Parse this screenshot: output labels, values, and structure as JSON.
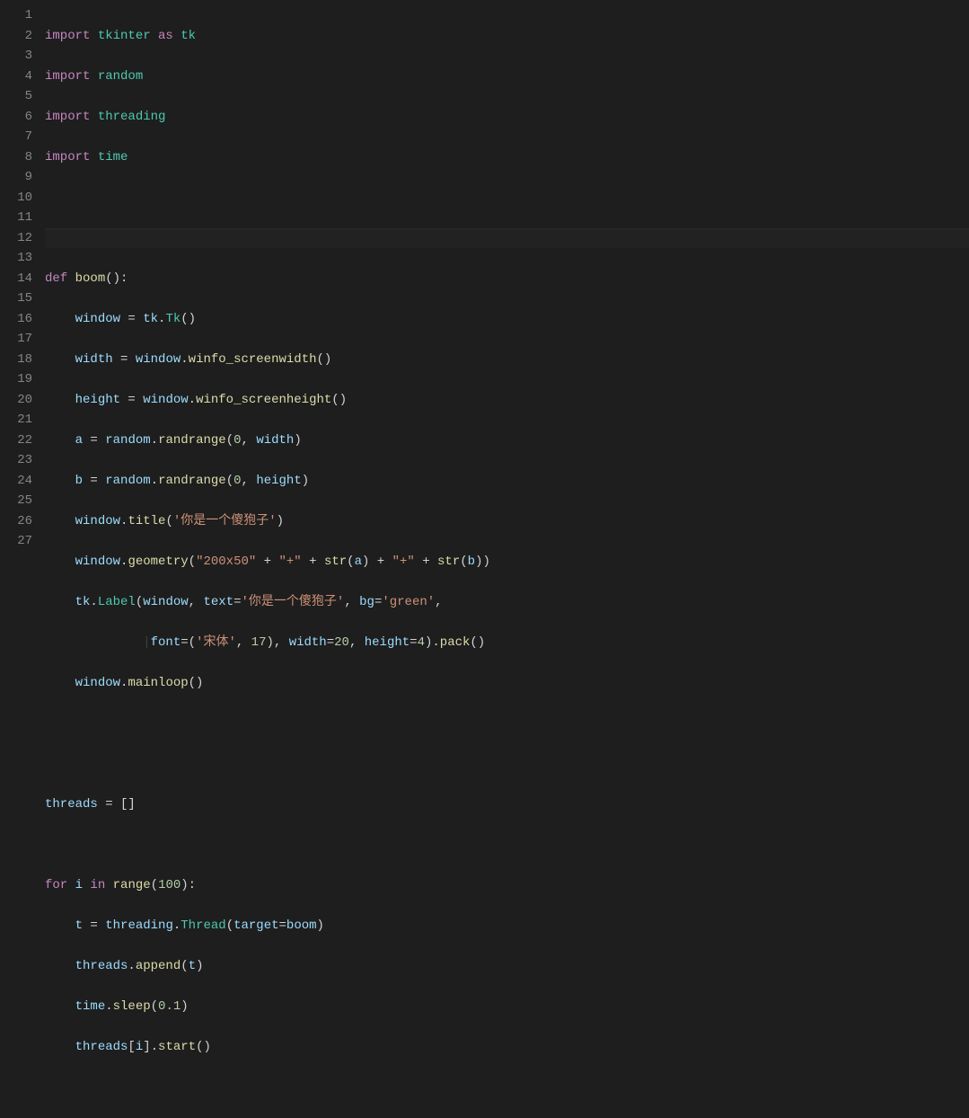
{
  "lineNumbers": [
    "1",
    "2",
    "3",
    "4",
    "5",
    "6",
    "7",
    "8",
    "9",
    "10",
    "11",
    "12",
    "13",
    "14",
    "15",
    "16",
    "17",
    "18",
    "19",
    "20",
    "21",
    "22",
    "23",
    "24",
    "25",
    "26",
    "27"
  ],
  "code": {
    "l1": {
      "import": "import ",
      "tk": "tkinter ",
      "as": "as ",
      "alias": "tk"
    },
    "l2": {
      "import": "import ",
      "mod": "random"
    },
    "l3": {
      "import": "import ",
      "mod": "threading"
    },
    "l4": {
      "import": "import ",
      "mod": "time"
    },
    "l7": {
      "def": "def ",
      "name": "boom",
      "paren": "():"
    },
    "l8": {
      "indent": "    ",
      "window": "window ",
      "eq": "= ",
      "tk": "tk",
      "dot": ".",
      "Tk": "Tk",
      "end": "()"
    },
    "l9": {
      "indent": "    ",
      "width": "width ",
      "eq": "= ",
      "window": "window",
      "dot": ".",
      "fn": "winfo_screenwidth",
      "end": "()"
    },
    "l10": {
      "indent": "    ",
      "height": "height ",
      "eq": "= ",
      "window": "window",
      "dot": ".",
      "fn": "winfo_screenheight",
      "end": "()"
    },
    "l11": {
      "indent": "    ",
      "a": "a ",
      "eq": "= ",
      "random": "random",
      "dot": ".",
      "fn": "randrange",
      "op": "(",
      "zero": "0",
      "comma": ", ",
      "width": "width",
      "cp": ")"
    },
    "l12": {
      "indent": "    ",
      "b": "b ",
      "eq": "= ",
      "random": "random",
      "dot": ".",
      "fn": "randrange",
      "op": "(",
      "zero": "0",
      "comma": ", ",
      "height": "height",
      "cp": ")"
    },
    "l13": {
      "indent": "    ",
      "window": "window",
      "dot": ".",
      "fn": "title",
      "op": "(",
      "str": "'你是一个傻狍子'",
      "cp": ")"
    },
    "l14": {
      "indent": "    ",
      "window": "window",
      "dot": ".",
      "fn": "geometry",
      "op": "(",
      "s1": "\"200x50\"",
      "plus1": " + ",
      "s2": "\"+\"",
      "plus2": " + ",
      "strf": "str",
      "opa": "(",
      "a": "a",
      "cpa": ")",
      "plus3": " + ",
      "s3": "\"+\"",
      "plus4": " + ",
      "strg": "str",
      "opb": "(",
      "b": "b",
      "cpb": ")",
      "cp": ")"
    },
    "l15": {
      "indent": "    ",
      "tk": "tk",
      "dot": ".",
      "Label": "Label",
      "op": "(",
      "window": "window",
      "comma1": ", ",
      "textk": "text",
      "eq1": "=",
      "textv": "'你是一个傻狍子'",
      "comma2": ", ",
      "bgk": "bg",
      "eq2": "=",
      "bgv": "'green'",
      "comma3": ","
    },
    "l16": {
      "indent": "             ",
      "guide": "|",
      "fontk": "font",
      "eq1": "=(",
      "fontname": "'宋体'",
      "comma1": ", ",
      "fontsize": "17",
      "cp1": ")",
      "comma2": ", ",
      "widthk": "width",
      "eq2": "=",
      "widthv": "20",
      "comma3": ", ",
      "heightk": "height",
      "eq3": "=",
      "heightv": "4",
      "cp2": ").",
      "pack": "pack",
      "end": "()"
    },
    "l17": {
      "indent": "    ",
      "window": "window",
      "dot": ".",
      "fn": "mainloop",
      "end": "()"
    },
    "l20": {
      "threads": "threads ",
      "eq": "= []"
    },
    "l22": {
      "for": "for ",
      "i": "i ",
      "in": "in ",
      "range": "range",
      "op": "(",
      "num": "100",
      "cp": "):"
    },
    "l23": {
      "indent": "    ",
      "t": "t ",
      "eq": "= ",
      "threading": "threading",
      "dot": ".",
      "Thread": "Thread",
      "op": "(",
      "target": "target",
      "eq2": "=",
      "boom": "boom",
      "cp": ")"
    },
    "l24": {
      "indent": "    ",
      "threads": "threads",
      "dot": ".",
      "fn": "append",
      "op": "(",
      "t": "t",
      "cp": ")"
    },
    "l25": {
      "indent": "    ",
      "time": "time",
      "dot": ".",
      "fn": "sleep",
      "op": "(",
      "num": "0.1",
      "cp": ")"
    },
    "l26": {
      "indent": "    ",
      "threads": "threads",
      "br": "[",
      "i": "i",
      "cbr": "].",
      "fn": "start",
      "end": "()"
    }
  }
}
